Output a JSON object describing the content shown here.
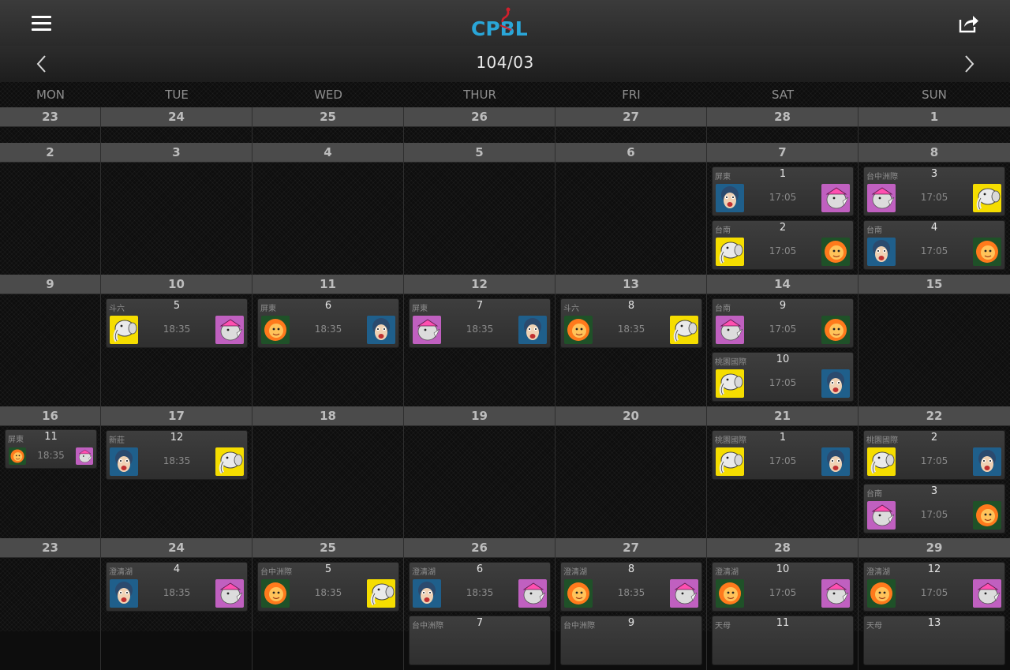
{
  "app": {
    "logo_text": "CPBL",
    "month_title": "104/03"
  },
  "colors": {
    "elephants": "#f5dd00",
    "monkeys": "#1f5f8b",
    "lions": "#1f5128",
    "rhinos": "#c060c0"
  },
  "weekdays": [
    "MON",
    "TUE",
    "WED",
    "THUR",
    "FRI",
    "SAT",
    "SUN"
  ],
  "weeks": [
    {
      "days": [
        {
          "date": "23",
          "games": []
        },
        {
          "date": "24",
          "games": []
        },
        {
          "date": "25",
          "games": []
        },
        {
          "date": "26",
          "games": []
        },
        {
          "date": "27",
          "games": []
        },
        {
          "date": "28",
          "games": []
        },
        {
          "date": "1",
          "games": []
        }
      ]
    },
    {
      "days": [
        {
          "date": "2",
          "games": []
        },
        {
          "date": "3",
          "games": []
        },
        {
          "date": "4",
          "games": []
        },
        {
          "date": "5",
          "games": []
        },
        {
          "date": "6",
          "games": []
        },
        {
          "date": "7",
          "games": [
            {
              "venue": "屏東",
              "no": "1",
              "time": "17:05",
              "away": "monkeys",
              "home": "rhinos"
            },
            {
              "venue": "台南",
              "no": "2",
              "time": "17:05",
              "away": "elephants",
              "home": "lions"
            }
          ]
        },
        {
          "date": "8",
          "games": [
            {
              "venue": "台中洲際",
              "no": "3",
              "time": "17:05",
              "away": "rhinos",
              "home": "elephants"
            },
            {
              "venue": "台南",
              "no": "4",
              "time": "17:05",
              "away": "monkeys",
              "home": "lions"
            }
          ]
        }
      ]
    },
    {
      "days": [
        {
          "date": "9",
          "games": []
        },
        {
          "date": "10",
          "games": [
            {
              "venue": "斗六",
              "no": "5",
              "time": "18:35",
              "away": "elephants",
              "home": "rhinos"
            }
          ]
        },
        {
          "date": "11",
          "games": [
            {
              "venue": "屏東",
              "no": "6",
              "time": "18:35",
              "away": "lions",
              "home": "monkeys"
            }
          ]
        },
        {
          "date": "12",
          "games": [
            {
              "venue": "屏東",
              "no": "7",
              "time": "18:35",
              "away": "rhinos",
              "home": "monkeys"
            }
          ]
        },
        {
          "date": "13",
          "games": [
            {
              "venue": "斗六",
              "no": "8",
              "time": "18:35",
              "away": "lions",
              "home": "elephants"
            }
          ]
        },
        {
          "date": "14",
          "games": [
            {
              "venue": "台南",
              "no": "9",
              "time": "17:05",
              "away": "rhinos",
              "home": "lions"
            },
            {
              "venue": "桃園國際",
              "no": "10",
              "time": "17:05",
              "away": "elephants",
              "home": "monkeys"
            }
          ]
        },
        {
          "date": "15",
          "games": []
        }
      ]
    },
    {
      "days": [
        {
          "date": "16",
          "games": [
            {
              "venue": "屏東",
              "no": "11",
              "time": "18:35",
              "away": "lions",
              "home": "rhinos"
            }
          ]
        },
        {
          "date": "17",
          "games": [
            {
              "venue": "新莊",
              "no": "12",
              "time": "18:35",
              "away": "monkeys",
              "home": "elephants"
            }
          ]
        },
        {
          "date": "18",
          "games": []
        },
        {
          "date": "19",
          "games": []
        },
        {
          "date": "20",
          "games": []
        },
        {
          "date": "21",
          "games": [
            {
              "venue": "桃園國際",
              "no": "1",
              "time": "17:05",
              "away": "elephants",
              "home": "monkeys"
            }
          ]
        },
        {
          "date": "22",
          "games": [
            {
              "venue": "桃園國際",
              "no": "2",
              "time": "17:05",
              "away": "elephants",
              "home": "monkeys"
            },
            {
              "venue": "台南",
              "no": "3",
              "time": "17:05",
              "away": "rhinos",
              "home": "lions"
            }
          ]
        }
      ]
    },
    {
      "days": [
        {
          "date": "23",
          "games": []
        },
        {
          "date": "24",
          "games": [
            {
              "venue": "澄清湖",
              "no": "4",
              "time": "18:35",
              "away": "monkeys",
              "home": "rhinos"
            }
          ]
        },
        {
          "date": "25",
          "games": [
            {
              "venue": "台中洲際",
              "no": "5",
              "time": "18:35",
              "away": "lions",
              "home": "elephants"
            }
          ]
        },
        {
          "date": "26",
          "games": [
            {
              "venue": "澄清湖",
              "no": "6",
              "time": "18:35",
              "away": "monkeys",
              "home": "rhinos"
            },
            {
              "venue": "台中洲際",
              "no": "7",
              "time": "",
              "away": "",
              "home": ""
            }
          ]
        },
        {
          "date": "27",
          "games": [
            {
              "venue": "澄清湖",
              "no": "8",
              "time": "18:35",
              "away": "lions",
              "home": "rhinos"
            },
            {
              "venue": "台中洲際",
              "no": "9",
              "time": "",
              "away": "",
              "home": ""
            }
          ]
        },
        {
          "date": "28",
          "games": [
            {
              "venue": "澄清湖",
              "no": "10",
              "time": "17:05",
              "away": "lions",
              "home": "rhinos"
            },
            {
              "venue": "天母",
              "no": "11",
              "time": "",
              "away": "",
              "home": ""
            }
          ]
        },
        {
          "date": "29",
          "games": [
            {
              "venue": "澄清湖",
              "no": "12",
              "time": "17:05",
              "away": "lions",
              "home": "rhinos"
            },
            {
              "venue": "天母",
              "no": "13",
              "time": "",
              "away": "",
              "home": ""
            }
          ]
        }
      ]
    }
  ]
}
